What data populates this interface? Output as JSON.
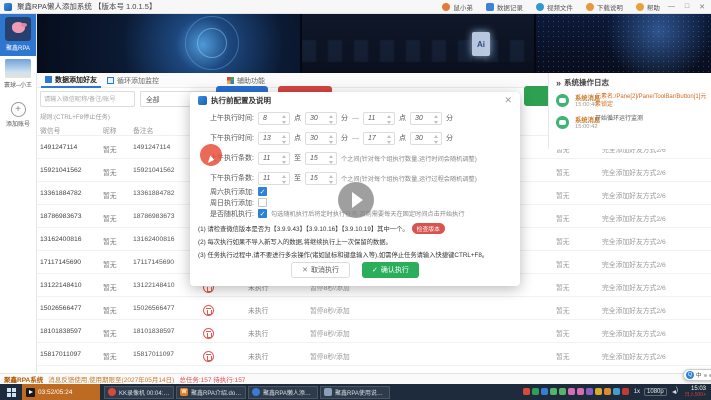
{
  "window_title": "聚鑫RPA懒人添加系统 【版本号 1.0.1.5】",
  "titlebar": {
    "items": [
      {
        "label": "鼠小弟",
        "icon": "user-avatar"
      },
      {
        "label": "数据记录",
        "icon": "document"
      },
      {
        "label": "视频文件",
        "icon": "video"
      },
      {
        "label": "下载说明",
        "icon": "download"
      },
      {
        "label": "帮助",
        "icon": "help"
      }
    ]
  },
  "banner": {
    "ai_label": "Ai"
  },
  "sidebar": {
    "items": [
      {
        "label": "聚鑫RPA",
        "selected": true
      },
      {
        "label": "寰球--小王",
        "selected": false
      },
      {
        "label": "添加账号",
        "selected": false
      }
    ]
  },
  "tabs": [
    {
      "label": "数据添加好友",
      "icon": "grid",
      "selected": true
    },
    {
      "label": "循环添加监控",
      "icon": "loop",
      "selected": false
    },
    {
      "label": "辅助功能",
      "icon": "win",
      "selected": false
    }
  ],
  "toolbar": {
    "search_placeholder": "请输入微信昵称/备注/账号",
    "filter_value": "全部",
    "hint": "规则:(CTRL+F8停止任务)"
  },
  "table": {
    "headers": {
      "id": "微信号",
      "nickname": "昵称",
      "remark": "备注名"
    },
    "rows": [
      {
        "wechat_id": "1491247114",
        "nickname": "暂无",
        "remark": "1491247114",
        "status": "未执行",
        "interval": "暂停8秒/添加",
        "extra": "暂无",
        "method": "完全添加好友方式2/6"
      },
      {
        "wechat_id": "15921041562",
        "nickname": "暂无",
        "remark": "15921041562",
        "status": "未执行",
        "interval": "暂停8秒/添加",
        "extra": "暂无",
        "method": "完全添加好友方式2/6"
      },
      {
        "wechat_id": "13361884782",
        "nickname": "暂无",
        "remark": "13361884782",
        "status": "未执行",
        "interval": "暂停8秒/添加",
        "extra": "暂无",
        "method": "完全添加好友方式2/6"
      },
      {
        "wechat_id": "18786983673",
        "nickname": "暂无",
        "remark": "18786983673",
        "status": "未执行",
        "interval": "暂停8秒/添加",
        "extra": "暂无",
        "method": "完全添加好友方式2/6"
      },
      {
        "wechat_id": "13162400816",
        "nickname": "暂无",
        "remark": "13162400816",
        "status": "未执行",
        "interval": "暂停8秒/添加",
        "extra": "暂无",
        "method": "完全添加好友方式2/6"
      },
      {
        "wechat_id": "17117145690",
        "nickname": "暂无",
        "remark": "17117145690",
        "status": "未执行",
        "interval": "暂停8秒/添加",
        "extra": "暂无",
        "method": "完全添加好友方式2/6"
      },
      {
        "wechat_id": "13122148410",
        "nickname": "暂无",
        "remark": "13122148410",
        "status": "未执行",
        "interval": "暂停8秒/添加",
        "extra": "暂无",
        "method": "完全添加好友方式2/6"
      },
      {
        "wechat_id": "15026566477",
        "nickname": "暂无",
        "remark": "15026566477",
        "status": "未执行",
        "interval": "暂停8秒/添加",
        "extra": "暂无",
        "method": "完全添加好友方式2/6"
      },
      {
        "wechat_id": "18101838597",
        "nickname": "暂无",
        "remark": "18101838597",
        "status": "未执行",
        "interval": "暂停8秒/添加",
        "extra": "暂无",
        "method": "完全添加好友方式2/6"
      },
      {
        "wechat_id": "15817011097",
        "nickname": "暂无",
        "remark": "15817011097",
        "status": "未执行",
        "interval": "暂停8秒/添加",
        "extra": "暂无",
        "method": "完全添加好友方式2/6"
      }
    ]
  },
  "dialog": {
    "title": "执行前配置及说明",
    "time_rows": [
      {
        "label": "上午执行时间:",
        "v1": "8",
        "u1": "点",
        "v2": "30",
        "u2": "分",
        "dash": "—",
        "v3": "11",
        "u3": "点",
        "v4": "30",
        "u4": "分"
      },
      {
        "label": "下午执行时间:",
        "v1": "13",
        "u1": "点",
        "v2": "30",
        "u2": "分",
        "dash": "—",
        "v3": "17",
        "u3": "点",
        "v4": "30",
        "u4": "分"
      }
    ],
    "count_rows": [
      {
        "label": "上午执行条数:",
        "v1": "11",
        "mid": "至",
        "v2": "15",
        "note": "个之间(针对每个组执行数量,运行时间会随机调整)"
      },
      {
        "label": "下午执行条数:",
        "v1": "11",
        "mid": "至",
        "v2": "15",
        "note": "个之间(针对每个组执行数量,运行过程会随机调整)"
      }
    ],
    "check_rows": [
      {
        "label": "周六执行添加:",
        "checked": true,
        "note": ""
      },
      {
        "label": "周日执行添加:",
        "checked": false,
        "note": ""
      },
      {
        "label": "是否随机执行:",
        "checked": true,
        "note": "勾选随机执行后将定时执行任务,否则需要每天在固定时间点击开始执行"
      }
    ],
    "notes": [
      {
        "text": "(1) 请检查微信版本是否为【3.9.9.43】【3.9.10.16】【3.9.10.19】其中一个。",
        "badge": "检查版本"
      },
      {
        "text": "(2) 每次执行如果不导入新写入的数据,将继续执行上一次保留的数据。",
        "badge": ""
      },
      {
        "text": "(3) 任务执行过程中,请不要进行多余操作(诸如鼠标和键盘输入等),如需停止任务请输入快捷键CTRL+F8。",
        "badge": ""
      }
    ],
    "cancel_label": "取消执行",
    "confirm_label": "确认执行"
  },
  "log_panel": {
    "title": "系统操作日志",
    "entries": [
      {
        "source": "系统消息",
        "time": "15:00:40",
        "text": "元素名:/Pane[2]/Pane/ToolBar/Button[1]元素锁定",
        "tone": "warn"
      },
      {
        "source": "系统消息",
        "time": "15:00:42",
        "text": "开始循环运行监测",
        "tone": "normal"
      }
    ]
  },
  "status_bar": {
    "app": "聚鑫RPA系统",
    "license": "消息反馈使用,使用期限至(2027年05月14日)",
    "stats": "总任务:157 待执行:157"
  },
  "taskbar": {
    "active_tile": "03:52/05:24",
    "windows": [
      {
        "label": "KK录像机 00:04:10",
        "icon": "kk"
      },
      {
        "label": "聚鑫RPA介绍.doc...",
        "icon": "wps"
      },
      {
        "label": "聚鑫RPA懒人添加...",
        "icon": "rpa"
      },
      {
        "label": "聚鑫RPA使用说明...",
        "icon": "doc"
      }
    ],
    "tray": [
      "#d9483b",
      "#2f9e57",
      "#3a7bd5",
      "#57b26a",
      "#57b26a",
      "#d56db0",
      "#d56db0",
      "#8a5fc0",
      "#d9a92f",
      "#e08a2e",
      "#3fa0d0",
      "#c23b2e"
    ],
    "speed": "1x",
    "quality": "1080p",
    "clock": "15:03",
    "watermark": "日入500+"
  },
  "ime_bar": {
    "q": "Q",
    "lang": "中"
  },
  "colors": {
    "accent_blue": "#2b77d3",
    "danger_red": "#d9534f",
    "success_green": "#2bae5c",
    "warn_orange": "#d2691e",
    "wechat_green": "#3eb575",
    "taskbar_bg": "#1d2b3c",
    "taskbar_active_orange": "#bd6b22",
    "click_highlight_red": "#e8503a"
  }
}
